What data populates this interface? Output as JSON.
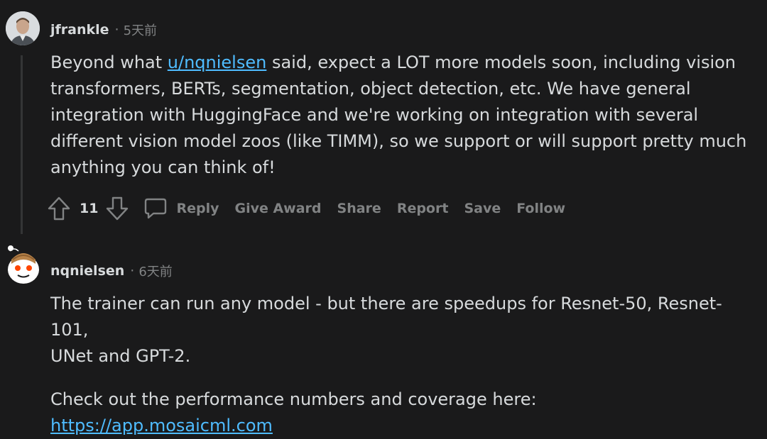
{
  "comments": [
    {
      "author": "jfrankle",
      "time": "5天前",
      "body": {
        "pre": "Beyond what ",
        "mention": "u/nqnielsen",
        "post_line1": " said, expect a LOT more models soon, including vision",
        "line2": "transformers, BERTs, segmentation, object detection, etc. We have general",
        "line3": "integration with HuggingFace and we're working on integration with several",
        "line4": "different vision model zoos (like TIMM), so we support or will support pretty much",
        "line5": "anything you can think of!"
      },
      "score": "11",
      "actions": {
        "reply": "Reply",
        "give_award": "Give Award",
        "share": "Share",
        "report": "Report",
        "save": "Save",
        "follow": "Follow"
      }
    },
    {
      "author": "nqnielsen",
      "time": "6天前",
      "body": {
        "line1": "The trainer can run any model - but there are speedups for Resnet-50, Resnet-101,",
        "line2": "UNet and GPT-2.",
        "link_pre": "Check out the performance numbers and coverage here: ",
        "link": "https://app.mosaicml.com"
      }
    }
  ],
  "colors": {
    "background": "#1a1a1b",
    "text": "#d7dadc",
    "muted": "#818384",
    "link": "#4fbcff"
  }
}
